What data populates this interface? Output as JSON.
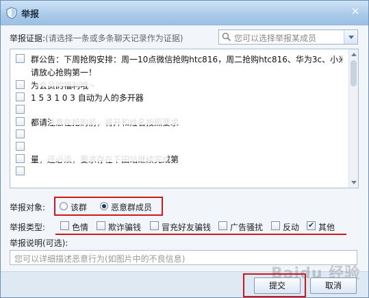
{
  "window": {
    "title": "举报",
    "close_glyph": "×"
  },
  "evidence": {
    "label": "举报证据:",
    "hint": "(请选择一条或多条聊天记录作为证据)",
    "member_search_placeholder": "您可以选择举报某成员"
  },
  "messages": [
    "群公告：下周抢购安排：周一10点微信抢购htc816，周二抢购htc816、华为3c、小米，",
    "                                              请放心抢购第一！",
    "                          为会员的福利哦~",
    "      1 5 3 1 0 3                     自动为人的多开器",
    "",
    "                                   都请注意在抢购前，将开和姓名按照要求",
    "",
    "",
    "                    量，还必须，要求存在下田站继续完成第",
    ""
  ],
  "target": {
    "label": "举报对象:",
    "options": [
      "该群",
      "恶意群成员"
    ],
    "selected": "恶意群成员"
  },
  "type": {
    "label": "举报类型:",
    "options": [
      {
        "label": "色情",
        "checked": false
      },
      {
        "label": "欺诈骗钱",
        "checked": false
      },
      {
        "label": "冒充好友骗钱",
        "checked": false
      },
      {
        "label": "广告骚扰",
        "checked": false
      },
      {
        "label": "反动",
        "checked": false
      },
      {
        "label": "其他",
        "checked": true
      }
    ]
  },
  "description": {
    "label": "举报说明(可选):",
    "placeholder": "您可以详细描述恶意行为(如图片中的不良信息)"
  },
  "buttons": {
    "submit": "提交",
    "cancel": "取消"
  },
  "watermark": "Baidu 经验",
  "colors": {
    "highlight_red": "#d0161b",
    "titlebar": "#a9c9e8",
    "accent_blue": "#3a6ea5"
  }
}
